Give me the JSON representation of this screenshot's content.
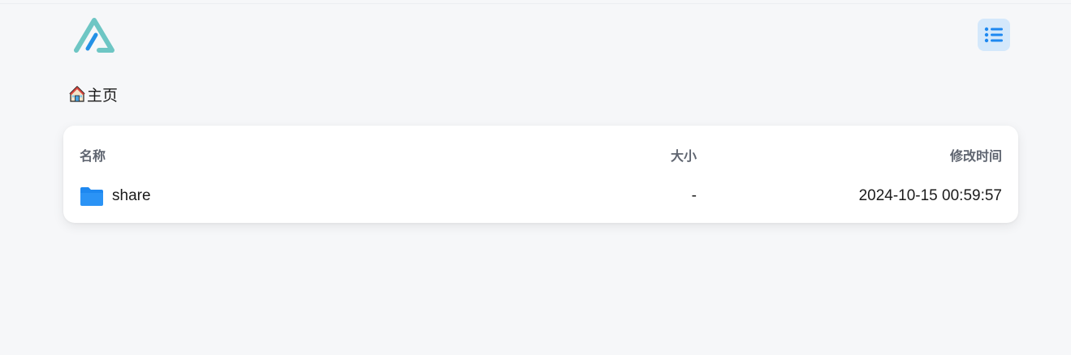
{
  "header": {
    "logo": "alist-logo",
    "menu_icon": "list-icon"
  },
  "breadcrumb": {
    "icon": "house-icon",
    "label": "主页"
  },
  "table": {
    "columns": {
      "name": "名称",
      "size": "大小",
      "modified": "修改时间"
    },
    "rows": [
      {
        "icon": "folder-icon",
        "name": "share",
        "size": "-",
        "modified": "2024-10-15 00:59:57"
      }
    ]
  },
  "colors": {
    "accent": "#1e88f0",
    "logo_teal": "#6ec6c4",
    "logo_blue": "#2391e6",
    "menu_bg": "#d4e8fb",
    "page_bg": "#f6f7f9"
  }
}
